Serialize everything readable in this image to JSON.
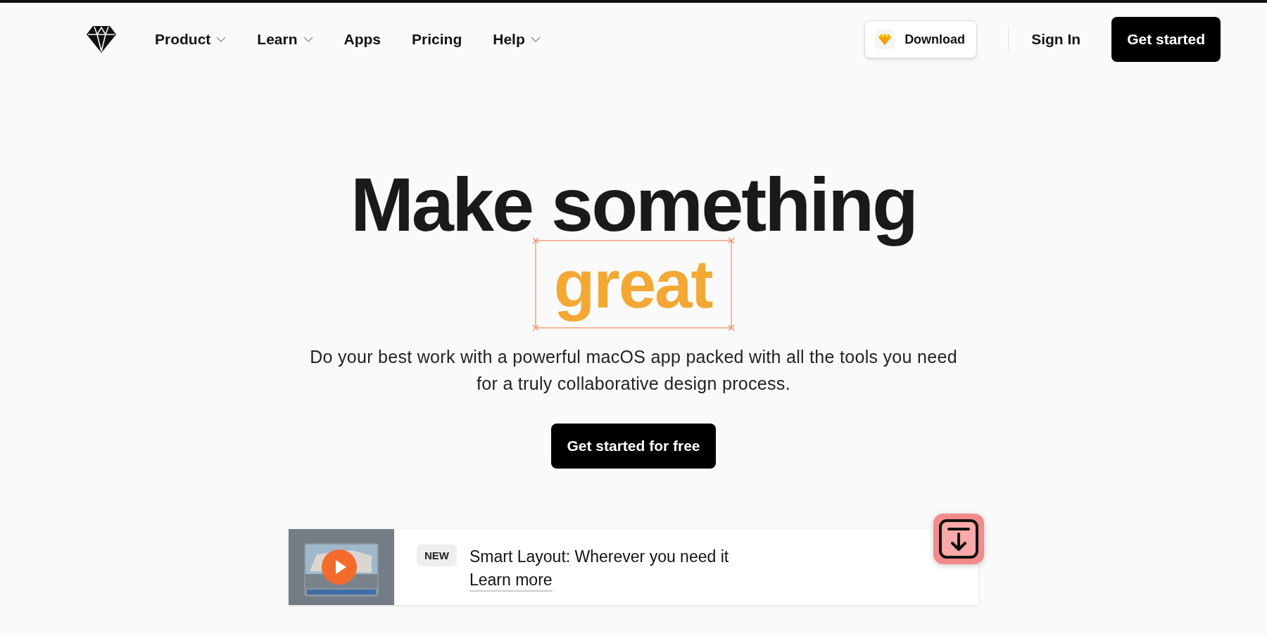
{
  "nav": {
    "items": [
      {
        "label": "Product",
        "dropdown": true
      },
      {
        "label": "Learn",
        "dropdown": true
      },
      {
        "label": "Apps",
        "dropdown": false
      },
      {
        "label": "Pricing",
        "dropdown": false
      },
      {
        "label": "Help",
        "dropdown": true
      }
    ],
    "download": "Download",
    "sign_in": "Sign In",
    "get_started": "Get started"
  },
  "hero": {
    "title": "Make something",
    "highlight": "great",
    "subtitle": "Do your best work with a powerful macOS app packed with all the tools you need for a truly collaborative design process.",
    "cta": "Get started for free"
  },
  "banner": {
    "badge": "NEW",
    "headline": "Smart Layout: Wherever you need it",
    "link": "Learn more"
  }
}
